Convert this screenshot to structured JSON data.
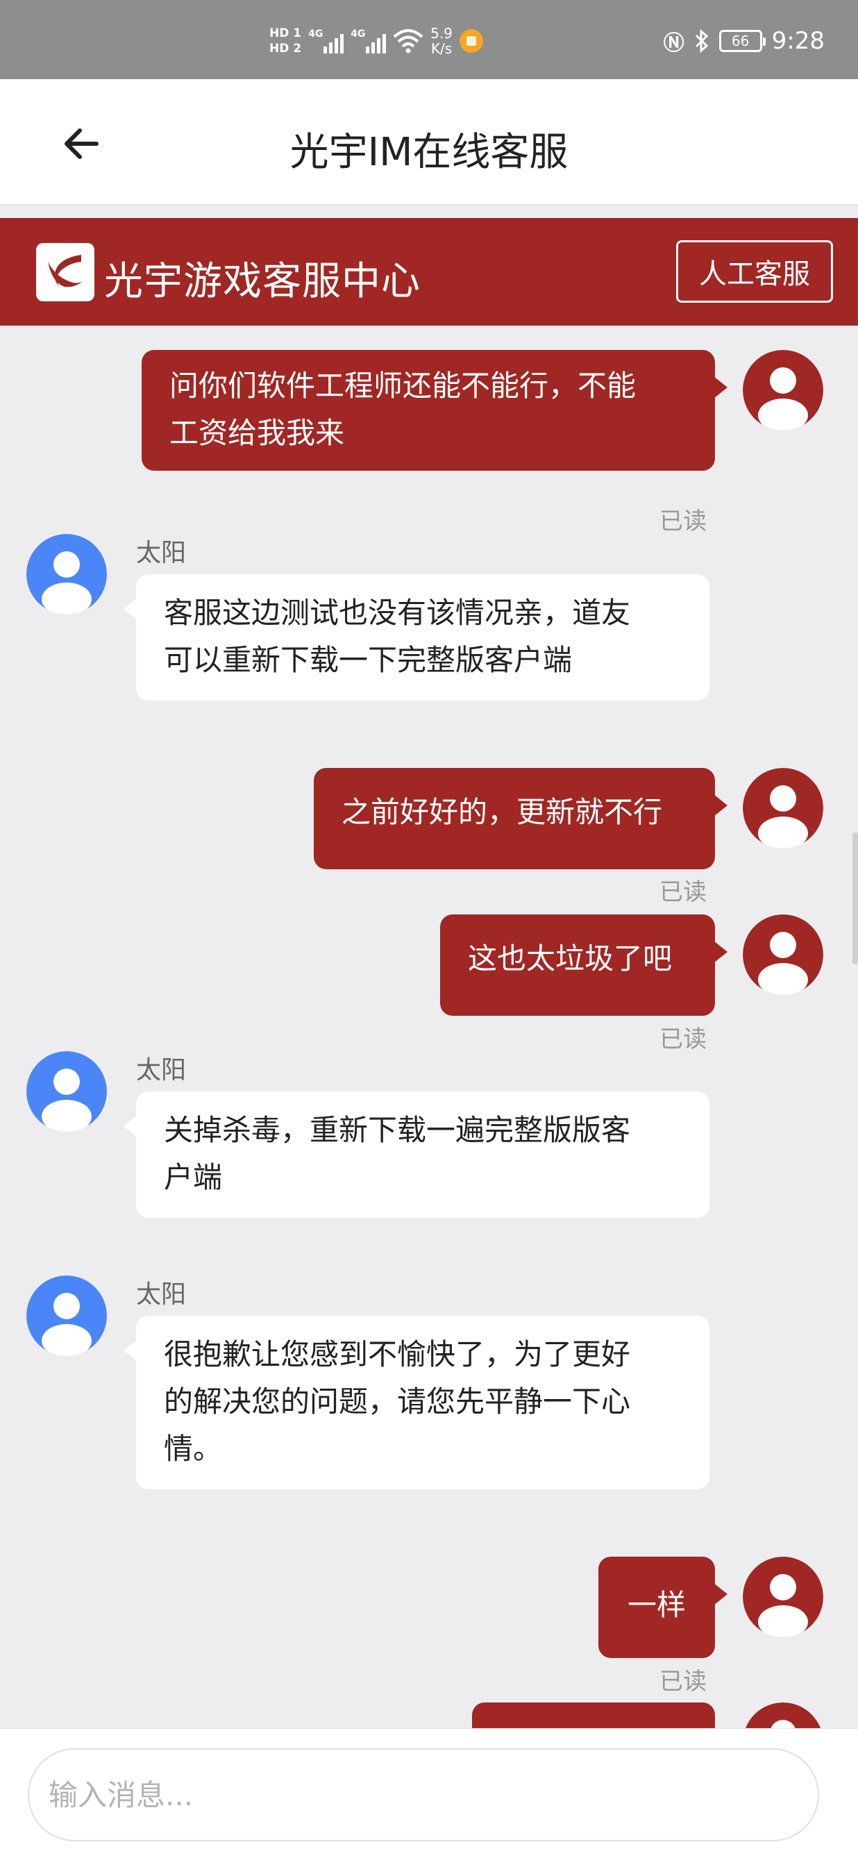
{
  "status_bar": {
    "hd1": "HD 1",
    "hd2": "HD 2",
    "sim1_label": "4G",
    "sim2_label": "4G",
    "net_speed_value": "5.9",
    "net_speed_unit": "K/s",
    "battery": "66",
    "time": "9:28"
  },
  "header": {
    "title": "光宇IM在线客服"
  },
  "banner": {
    "title": "光宇游戏客服中心",
    "human_button": "人工客服"
  },
  "colors": {
    "brand": "#a02723",
    "agent_avatar": "#4a86f7",
    "user_bubble_text": "#ffffff",
    "agent_bubble": "#ffffff"
  },
  "messages": [
    {
      "from": "user",
      "lines": [
        "问你们软件工程师还能不能行，不能",
        "工资给我我来"
      ],
      "status": "已读"
    },
    {
      "from": "agent",
      "sender": "太阳",
      "lines": [
        "客服这边测试也没有该情况亲，道友",
        "可以重新下载一下完整版客户端"
      ]
    },
    {
      "from": "user",
      "lines": [
        "之前好好的，更新就不行"
      ],
      "status": "已读"
    },
    {
      "from": "user",
      "lines": [
        "这也太垃圾了吧"
      ],
      "status": "已读"
    },
    {
      "from": "agent",
      "sender": "太阳",
      "lines": [
        "关掉杀毒，重新下载一遍完整版版客",
        "户端"
      ]
    },
    {
      "from": "agent",
      "sender": "太阳",
      "lines": [
        "很抱歉让您感到不愉快了，为了更好",
        "的解决您的问题，请您先平静一下心",
        "情。"
      ]
    },
    {
      "from": "user",
      "lines": [
        "一样"
      ],
      "status": "已读"
    }
  ],
  "input": {
    "placeholder": "输入消息..."
  }
}
